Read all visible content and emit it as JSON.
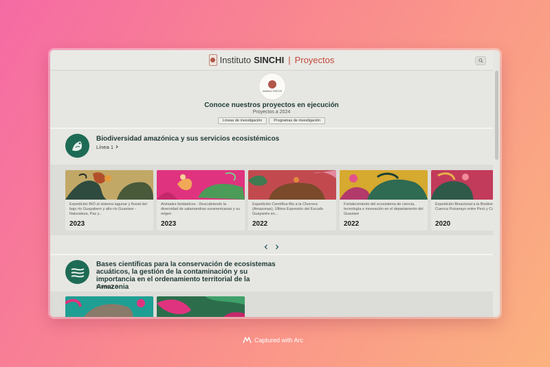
{
  "header": {
    "brand_name": "Instituto",
    "brand_strong": "SINCHI",
    "section": "Proyectos",
    "search_icon": "search-icon"
  },
  "hero": {
    "logo_text": "Instituto SINCHI",
    "title": "Conoce nuestros proyectos en ejecución",
    "subtitle": "Proyectos a 2024",
    "tabs": [
      "Líneas de investigación",
      "Programas de investigación"
    ]
  },
  "lines": [
    {
      "title": "Biodiversidad amazónica y sus servicios ecosistémicos",
      "link": "Línea 1",
      "icon": "biodiversity-icon",
      "cards": [
        {
          "text": "Expedición BIO al sistema lagunar y fluvial del bajo río Guayabero y alto río Guaviare - Naturaleza, Paz y...",
          "year": "2023",
          "bg": "#c2a867"
        },
        {
          "text": "Animales fantásticos - Descubriendo la diversidad de salamandras suramericanas y su origen",
          "year": "2023",
          "bg": "#e0337f"
        },
        {
          "text": "Expedición Científica-Bio a la Chorrera (Amazonas), Última Expresión del Escudo Guayanés en...",
          "year": "2022",
          "bg": "#c24a4f"
        },
        {
          "text": "Fortalecimiento del ecosistema de ciencia, tecnología e innovación en el departamento del Guaviare",
          "year": "2022",
          "bg": "#d6a92f"
        },
        {
          "text": "Expedición Binacional a la Biodiversidad de la Cuenca Putumayo entre Perú y Colombia",
          "year": "2020",
          "bg": "#c23b5a"
        }
      ]
    },
    {
      "title": "Bases científicas para la conservación de ecosistemas acuáticos, la gestión de la contaminación y su importancia en el ordenamiento territorial de la Amazonia",
      "link": "Línea 2",
      "icon": "river-icon",
      "cards": [
        {
          "bg": "#1f9f93"
        },
        {
          "bg": "#2c6e4c"
        }
      ]
    }
  ],
  "capture": {
    "label": "Captured with Arc",
    "icon": "arc-icon"
  },
  "colors": {
    "accent": "#c24a3c",
    "line_icon_bg": "#1e6b55",
    "title_text": "#1f3b3a"
  }
}
